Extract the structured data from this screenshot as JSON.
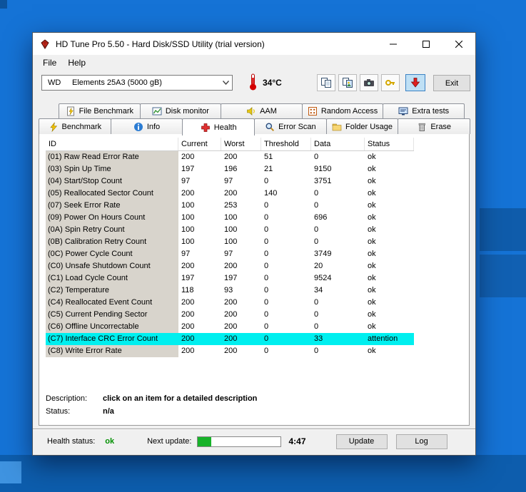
{
  "window": {
    "title": "HD Tune Pro 5.50 - Hard Disk/SSD Utility (trial version)"
  },
  "menu": {
    "file": "File",
    "help": "Help"
  },
  "toolbar": {
    "drive_vendor": "WD",
    "drive_model": "Elements 25A3 (5000 gB)",
    "temperature": "34°C",
    "exit_label": "Exit"
  },
  "tabs": {
    "row1": [
      {
        "label": "File Benchmark",
        "icon": "file-benchmark-icon"
      },
      {
        "label": "Disk monitor",
        "icon": "disk-monitor-icon"
      },
      {
        "label": "AAM",
        "icon": "aam-icon"
      },
      {
        "label": "Random Access",
        "icon": "random-access-icon"
      },
      {
        "label": "Extra tests",
        "icon": "extra-tests-icon"
      }
    ],
    "row2": [
      {
        "label": "Benchmark",
        "icon": "benchmark-icon"
      },
      {
        "label": "Info",
        "icon": "info-icon"
      },
      {
        "label": "Health",
        "icon": "health-icon",
        "active": true
      },
      {
        "label": "Error Scan",
        "icon": "error-scan-icon"
      },
      {
        "label": "Folder Usage",
        "icon": "folder-usage-icon"
      },
      {
        "label": "Erase",
        "icon": "erase-icon"
      }
    ]
  },
  "health_table": {
    "columns": [
      "ID",
      "Current",
      "Worst",
      "Threshold",
      "Data",
      "Status"
    ],
    "rows": [
      {
        "id": "(01) Raw Read Error Rate",
        "current": "200",
        "worst": "200",
        "threshold": "51",
        "data": "0",
        "status": "ok"
      },
      {
        "id": "(03) Spin Up Time",
        "current": "197",
        "worst": "196",
        "threshold": "21",
        "data": "9150",
        "status": "ok"
      },
      {
        "id": "(04) Start/Stop Count",
        "current": "97",
        "worst": "97",
        "threshold": "0",
        "data": "3751",
        "status": "ok"
      },
      {
        "id": "(05) Reallocated Sector Count",
        "current": "200",
        "worst": "200",
        "threshold": "140",
        "data": "0",
        "status": "ok"
      },
      {
        "id": "(07) Seek Error Rate",
        "current": "100",
        "worst": "253",
        "threshold": "0",
        "data": "0",
        "status": "ok"
      },
      {
        "id": "(09) Power On Hours Count",
        "current": "100",
        "worst": "100",
        "threshold": "0",
        "data": "696",
        "status": "ok"
      },
      {
        "id": "(0A) Spin Retry Count",
        "current": "100",
        "worst": "100",
        "threshold": "0",
        "data": "0",
        "status": "ok"
      },
      {
        "id": "(0B) Calibration Retry Count",
        "current": "100",
        "worst": "100",
        "threshold": "0",
        "data": "0",
        "status": "ok"
      },
      {
        "id": "(0C) Power Cycle Count",
        "current": "97",
        "worst": "97",
        "threshold": "0",
        "data": "3749",
        "status": "ok"
      },
      {
        "id": "(C0) Unsafe Shutdown Count",
        "current": "200",
        "worst": "200",
        "threshold": "0",
        "data": "20",
        "status": "ok"
      },
      {
        "id": "(C1) Load Cycle Count",
        "current": "197",
        "worst": "197",
        "threshold": "0",
        "data": "9524",
        "status": "ok"
      },
      {
        "id": "(C2) Temperature",
        "current": "118",
        "worst": "93",
        "threshold": "0",
        "data": "34",
        "status": "ok"
      },
      {
        "id": "(C4) Reallocated Event Count",
        "current": "200",
        "worst": "200",
        "threshold": "0",
        "data": "0",
        "status": "ok"
      },
      {
        "id": "(C5) Current Pending Sector",
        "current": "200",
        "worst": "200",
        "threshold": "0",
        "data": "0",
        "status": "ok"
      },
      {
        "id": "(C6) Offline Uncorrectable",
        "current": "200",
        "worst": "200",
        "threshold": "0",
        "data": "0",
        "status": "ok"
      },
      {
        "id": "(C7) Interface CRC Error Count",
        "current": "200",
        "worst": "200",
        "threshold": "0",
        "data": "33",
        "status": "attention",
        "highlighted": true
      },
      {
        "id": "(C8) Write Error Rate",
        "current": "200",
        "worst": "200",
        "threshold": "0",
        "data": "0",
        "status": "ok"
      }
    ]
  },
  "details": {
    "description_label": "Description:",
    "description_value": "click on an item for a detailed description",
    "status_label": "Status:",
    "status_value": "n/a"
  },
  "statusbar": {
    "health_label": "Health status:",
    "health_value": "ok",
    "next_update_label": "Next update:",
    "progress_percent": 16,
    "countdown": "4:47",
    "update_label": "Update",
    "log_label": "Log"
  }
}
